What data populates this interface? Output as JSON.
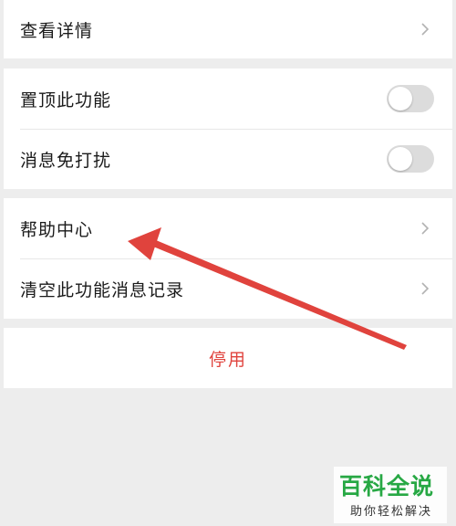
{
  "settings": {
    "view_details": "查看详情",
    "pin_feature": "置顶此功能",
    "pin_feature_enabled": false,
    "mute_messages": "消息免打扰",
    "mute_messages_enabled": false,
    "help_center": "帮助中心",
    "clear_history": "清空此功能消息记录",
    "disable": "停用"
  },
  "watermark": {
    "title": "百科全说",
    "subtitle": "助你轻松解决"
  },
  "colors": {
    "background": "#ededed",
    "danger": "#e0433d",
    "arrow": "#e0433d",
    "watermark": "#27a844",
    "toggle_off": "#dcdcdc"
  },
  "icons": {
    "chevron": "chevron-right-icon",
    "annotation": "red-arrow-annotation"
  }
}
